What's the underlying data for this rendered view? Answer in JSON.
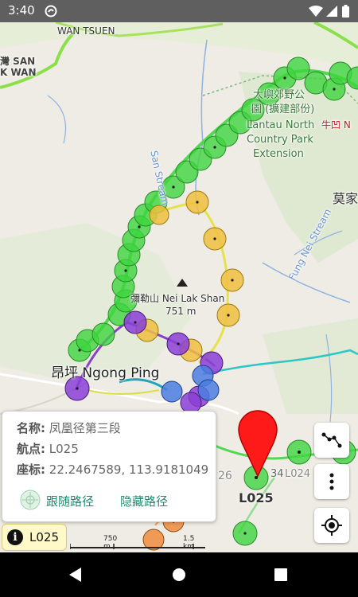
{
  "status_bar": {
    "time": "3:40"
  },
  "map": {
    "labels": {
      "wan_tsuen": "WAN TSUEN",
      "san_wan_cn": "灣 SAN",
      "k_wan": "K WAN",
      "lantau_cn_1": "大嶼郊野公",
      "lantau_cn_2": "園 (擴建部份)",
      "lantau_en_1": "Lantau North",
      "lantau_en_2": "Country Park",
      "lantau_en_3": "Extension",
      "ngau_au": "牛凹 N",
      "mok_ka": "莫家",
      "ngong_ping": "昂坪 Ngong Ping",
      "nei_lak_shan": "彌勒山 Nei Lak Shan",
      "elevation": "751 m",
      "san_stream": "San Stream",
      "fung_nei_stream": "Fung Nei Stream",
      "pin_label": "L025",
      "bottom_26": "26",
      "bottom_34": "34",
      "bottom_l024": "L024"
    }
  },
  "popup": {
    "name_label": "名称:",
    "name_value": "凤凰径第三段",
    "waypoint_label": "航点:",
    "waypoint_value": "L025",
    "coord_label": "座标:",
    "coord_value": "22.2467589, 113.9181049",
    "follow_label": "跟随路径",
    "hide_label": "隐藏路径"
  },
  "info_chip": {
    "icon": "i",
    "label": "L025"
  },
  "scale": {
    "left": "750 m",
    "right": "1.5 km"
  }
}
